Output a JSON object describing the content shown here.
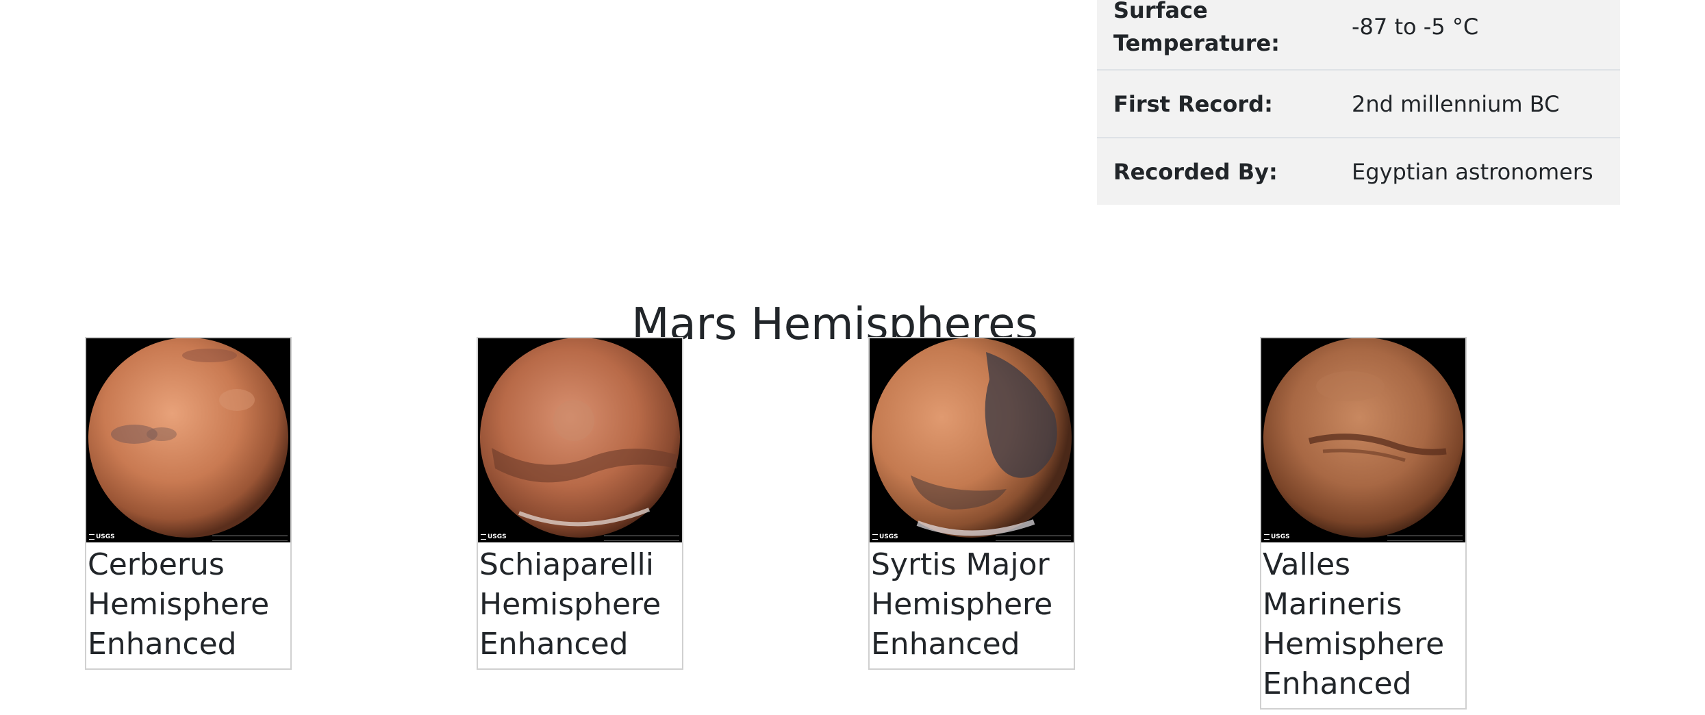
{
  "facts": [
    {
      "label": "Surface Temperature:",
      "value": "-87 to -5 °C"
    },
    {
      "label": "First Record:",
      "value": "2nd millennium BC"
    },
    {
      "label": "Recorded By:",
      "value": "Egyptian astronomers"
    }
  ],
  "hemispheres": {
    "title": "Mars Hemispheres",
    "items": [
      {
        "caption": "Cerberus Hemisphere Enhanced",
        "logo": "USGS"
      },
      {
        "caption": "Schiaparelli Hemisphere Enhanced",
        "logo": "USGS"
      },
      {
        "caption": "Syrtis Major Hemisphere Enhanced",
        "logo": "USGS"
      },
      {
        "caption": "Valles Marineris Hemisphere Enhanced",
        "logo": "USGS"
      }
    ]
  },
  "colors": {
    "text": "#212529",
    "table_bg": "#f2f2f2",
    "card_border": "#d0d0d0",
    "image_bg": "#000000"
  },
  "icons": {
    "hemisphere_image": "mars-globe-image",
    "logo": "usgs-logo"
  }
}
